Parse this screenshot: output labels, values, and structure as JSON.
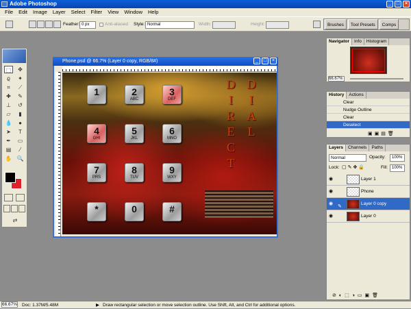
{
  "app": {
    "title": "Adobe Photoshop"
  },
  "menu": [
    "File",
    "Edit",
    "Image",
    "Layer",
    "Select",
    "Filter",
    "View",
    "Window",
    "Help"
  ],
  "options": {
    "feather_label": "Feather:",
    "feather_value": "0 px",
    "anti_aliased": "Anti-aliased",
    "style_label": "Style:",
    "style_value": "Normal",
    "width_label": "Width:",
    "height_label": "Height:"
  },
  "well_tabs": [
    "Brushes",
    "Tool Presets",
    "Comps"
  ],
  "document": {
    "title": "Phone.psd @ 66.7% (Layer 0 copy, RGB/8#)"
  },
  "keypad": [
    {
      "digit": "1",
      "letters": ""
    },
    {
      "digit": "2",
      "letters": "ABC"
    },
    {
      "digit": "3",
      "letters": "DEF"
    },
    {
      "digit": "4",
      "letters": "GHI"
    },
    {
      "digit": "5",
      "letters": "JKL"
    },
    {
      "digit": "6",
      "letters": "MNO"
    },
    {
      "digit": "7",
      "letters": "PRS"
    },
    {
      "digit": "8",
      "letters": "TUV"
    },
    {
      "digit": "9",
      "letters": "WXY"
    },
    {
      "digit": "*",
      "letters": ""
    },
    {
      "digit": "0",
      "letters": ""
    },
    {
      "digit": "#",
      "letters": ""
    }
  ],
  "word_direct": [
    "D",
    "I",
    "R",
    "E",
    "C",
    "T"
  ],
  "word_dial": [
    "D",
    "I",
    "A",
    "L"
  ],
  "navigator": {
    "tabs": [
      "Navigator",
      "Info",
      "Histogram"
    ],
    "zoom": "66.67%"
  },
  "history": {
    "tabs": [
      "History",
      "Actions"
    ],
    "items": [
      "Clear",
      "Nudge Outline",
      "Clear",
      "Deselect"
    ]
  },
  "layers": {
    "tabs": [
      "Layers",
      "Channels",
      "Paths"
    ],
    "blend_mode": "Normal",
    "opacity_label": "Opacity:",
    "opacity": "100%",
    "lock_label": "Lock:",
    "fill_label": "Fill:",
    "fill": "100%",
    "items": [
      "Layer 1",
      "Phone",
      "Layer 0 copy",
      "Layer 0"
    ]
  },
  "status": {
    "zoom": "66.67%",
    "doc": "Doc: 1.37M/5.48M",
    "hint": "Draw rectangular selection or move selection outline.  Use Shift, Alt, and Ctrl for additional options."
  },
  "colors": {
    "foreground": "#000000",
    "background": "#e0202a",
    "accent": "#3169c6"
  }
}
